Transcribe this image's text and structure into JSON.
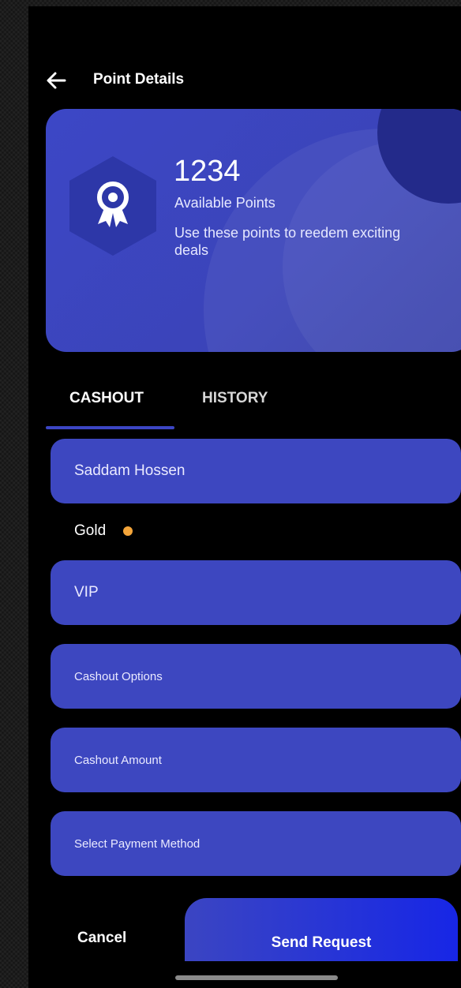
{
  "header": {
    "title": "Point Details",
    "back_icon": "arrow-left-icon"
  },
  "points_card": {
    "value": "1234",
    "label": "Available Points",
    "description": "Use these points to reedem exciting deals",
    "badge_icon": "award-ribbon-icon",
    "colors": {
      "card": "#3c47c6",
      "badge": "#2d37a8"
    }
  },
  "tabs": [
    {
      "label": "CASHOUT",
      "active": true
    },
    {
      "label": "HISTORY",
      "active": false
    }
  ],
  "form": {
    "name_value": "Saddam Hossen",
    "level_label": "Gold",
    "tier_value": "VIP",
    "cashout_options_placeholder": "Cashout Options",
    "cashout_amount_placeholder": "Cashout Amount",
    "payment_method_placeholder": "Select Payment Method"
  },
  "actions": {
    "cancel_label": "Cancel",
    "send_label": "Send Request"
  },
  "colors": {
    "background": "#000000",
    "field": "#3d47c0",
    "accent": "#3c46c4",
    "gold_dot": "#f4a53a",
    "send_gradient_end": "#1726e6"
  }
}
